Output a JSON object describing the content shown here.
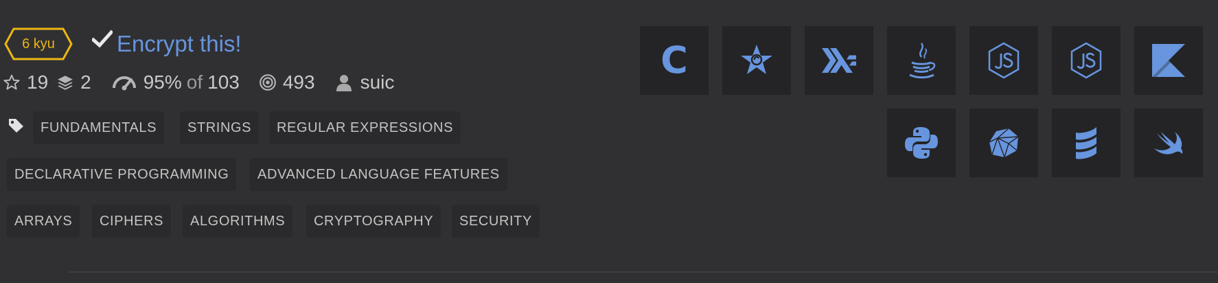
{
  "kata": {
    "rank": "6 kyu",
    "title": "Encrypt this!",
    "colors": {
      "rank": "#ecb613",
      "title": "#6795de",
      "tile_icon": "#6795de",
      "tile_bg": "#242426"
    }
  },
  "stats": {
    "stars": "19",
    "collections": "2",
    "satisfaction_percent": "95%",
    "satisfaction_of": "of",
    "satisfaction_votes": "103",
    "completed": "493",
    "author": "suic"
  },
  "tags": [
    "FUNDAMENTALS",
    "STRINGS",
    "REGULAR EXPRESSIONS",
    "DECLARATIVE PROGRAMMING",
    "ADVANCED LANGUAGE FEATURES",
    "ARRAYS",
    "CIPHERS",
    "ALGORITHMS",
    "CRYPTOGRAPHY",
    "SECURITY"
  ],
  "languages": [
    {
      "name": "c",
      "icon": "c-icon",
      "label": "C"
    },
    {
      "name": "crystal",
      "icon": "crystal-star-icon"
    },
    {
      "name": "haskell",
      "icon": "haskell-icon"
    },
    {
      "name": "java",
      "icon": "java-icon"
    },
    {
      "name": "javascript",
      "icon": "javascript-icon"
    },
    {
      "name": "typescript",
      "icon": "javascript-icon"
    },
    {
      "name": "kotlin",
      "icon": "kotlin-icon"
    },
    {
      "name": "python",
      "icon": "python-icon"
    },
    {
      "name": "ruby",
      "icon": "ruby-icon"
    },
    {
      "name": "scala",
      "icon": "scala-icon"
    },
    {
      "name": "swift",
      "icon": "swift-icon"
    }
  ]
}
